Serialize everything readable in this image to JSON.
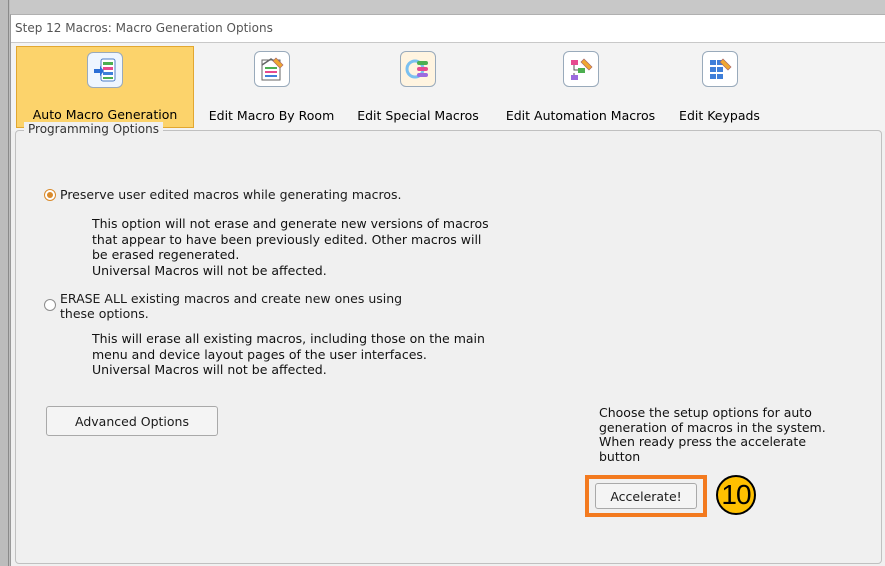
{
  "window": {
    "title": "Step 12 Macros: Macro Generation Options"
  },
  "toolbar": {
    "items": [
      {
        "label": "Auto Macro Generation",
        "icon": "auto-macro-icon",
        "active": true
      },
      {
        "label": "Edit Macro By Room",
        "icon": "room-macro-icon",
        "active": false
      },
      {
        "label": "Edit Special Macros",
        "icon": "special-macro-icon",
        "active": false
      },
      {
        "label": "Edit Automation Macros",
        "icon": "automation-macro-icon",
        "active": false
      },
      {
        "label": "Edit Keypads",
        "icon": "keypad-icon",
        "active": false
      }
    ]
  },
  "options": {
    "group_title": "Programming Options",
    "preserve": {
      "label": "Preserve user edited macros while generating macros.",
      "selected": true,
      "desc": [
        "This option will not erase and generate new versions of macros",
        "that appear to have been previously edited. Other macros will",
        "be erased regenerated.",
        "Universal Macros will not be affected."
      ]
    },
    "erase": {
      "label": [
        "ERASE ALL existing macros and create new ones using",
        "these options."
      ],
      "selected": false,
      "desc": [
        "This will erase all existing macros, including those on the main",
        "menu and device layout pages of the user interfaces.",
        "Universal Macros will not be affected."
      ]
    }
  },
  "buttons": {
    "advanced_label": "Advanced Options",
    "accelerate_label": "Accelerate!"
  },
  "hint": [
    "Choose the setup options for auto",
    "generation of macros in the system.",
    "When ready press the accelerate",
    "button"
  ],
  "callout": {
    "number": "10",
    "color": "#ffc000"
  },
  "colors": {
    "highlight": "#f37a1f",
    "active_tab": "#fcd36b",
    "radio_selected": "#d98a2b"
  }
}
